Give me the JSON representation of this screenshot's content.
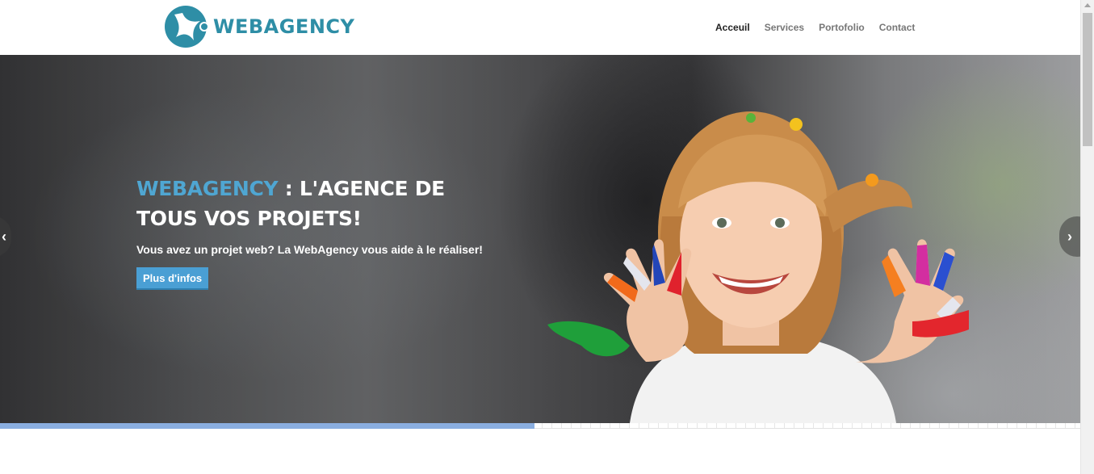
{
  "header": {
    "logo_text": "WEBAGENCY",
    "nav": [
      {
        "label": "Acceuil",
        "active": true
      },
      {
        "label": "Services",
        "active": false
      },
      {
        "label": "Portofolio",
        "active": false
      },
      {
        "label": "Contact",
        "active": false
      }
    ]
  },
  "slider": {
    "title_brand": "WEBAGENCY",
    "title_rest": " : L'AGENCE DE TOUS VOS PROJETS!",
    "subtitle": "Vous avez un projet web? La WebAgency vous aide à le réaliser!",
    "button_label": "Plus d'infos",
    "prev_icon": "chevron-left-icon",
    "next_icon": "chevron-right-icon",
    "next_glyph": "›",
    "prev_glyph": "‹",
    "progress": 0.495
  },
  "colors": {
    "brand": "#2e8ea6",
    "accent": "#4a9fd4",
    "progress": "#8aaee0"
  }
}
